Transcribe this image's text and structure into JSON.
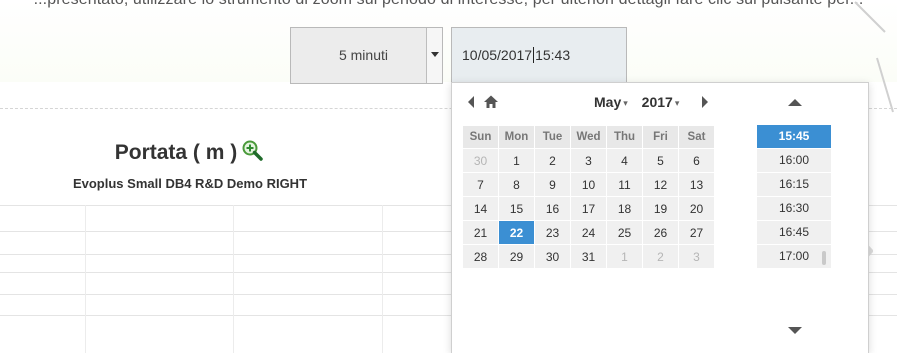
{
  "page": {
    "top_text": "...presentato, utilizzare lo strumento di zoom sul periodo di interesse; per ulteriori dettagli fare clic sul pulsante per..."
  },
  "controls": {
    "interval_select": {
      "value": "5 minuti"
    },
    "datetime_input": {
      "value_before_caret": "10/05/2017",
      "value_after_caret": "15:43"
    }
  },
  "chart": {
    "title": "Portata ( m )",
    "subtitle": "Evoplus Small DB4 R&D Demo RIGHT"
  },
  "datepicker": {
    "month": "May",
    "year": "2017",
    "dropdown_glyph": "▾",
    "weekdays": [
      "Sun",
      "Mon",
      "Tue",
      "Wed",
      "Thu",
      "Fri",
      "Sat"
    ],
    "weeks": [
      [
        "30",
        "1",
        "2",
        "3",
        "4",
        "5",
        "6"
      ],
      [
        "7",
        "8",
        "9",
        "10",
        "11",
        "12",
        "13"
      ],
      [
        "14",
        "15",
        "16",
        "17",
        "18",
        "19",
        "20"
      ],
      [
        "21",
        "22",
        "23",
        "24",
        "25",
        "26",
        "27"
      ],
      [
        "28",
        "29",
        "30",
        "31",
        "1",
        "2",
        "3"
      ]
    ],
    "other_month_cells": [
      "0-0",
      "4-4",
      "4-5",
      "4-6"
    ],
    "selected_day": "3-1",
    "times": [
      "15:45",
      "16:00",
      "16:15",
      "16:30",
      "16:45",
      "17:00"
    ],
    "selected_time_index": 0,
    "selected_color": "#3b8fd3"
  }
}
